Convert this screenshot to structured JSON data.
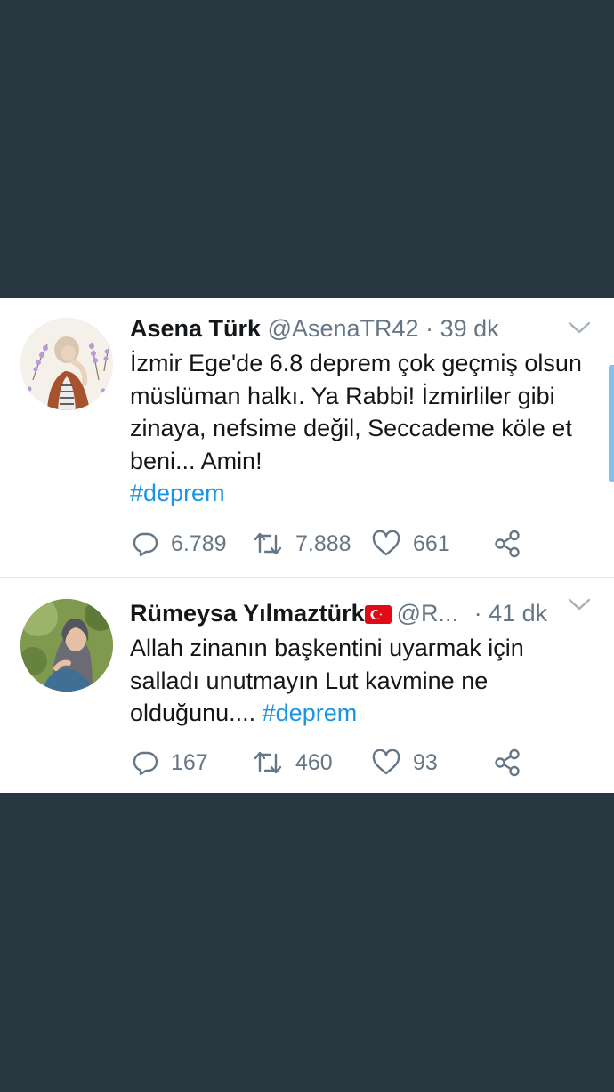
{
  "colors": {
    "background": "#283740",
    "card": "#ffffff",
    "text": "#14171a",
    "muted": "#657786",
    "link": "#1b95e0",
    "scroll_indicator": "#7ec3ee"
  },
  "tweets": [
    {
      "name": "Asena Türk",
      "handle": "@AsenaTR42",
      "separator": "·",
      "time": "39 dk",
      "text": "İzmir Ege'de 6.8  deprem çok geçmiş olsun müslüman halkı. Ya Rabbi! İzmirliler gibi zinaya, nefsime değil, Seccademe köle et beni... Amin!",
      "hashtag": "#deprem",
      "replies": "6.789",
      "retweets": "7.888",
      "likes": "661",
      "icons": [
        "reply-icon",
        "retweet-icon",
        "heart-icon",
        "share-icon",
        "chevron-down-icon"
      ]
    },
    {
      "name": "Rümeysa Yılmaztürk",
      "handle": "@R...",
      "separator": "·",
      "time": "41 dk",
      "text": "Allah zinanın başkentini uyarmak için salladı unutmayın Lut kavmine ne olduğunu....",
      "hashtag": "#deprem",
      "replies": "167",
      "retweets": "460",
      "likes": "93",
      "icons": [
        "turkish-flag-icon",
        "reply-icon",
        "retweet-icon",
        "heart-icon",
        "share-icon",
        "chevron-down-icon"
      ]
    }
  ]
}
